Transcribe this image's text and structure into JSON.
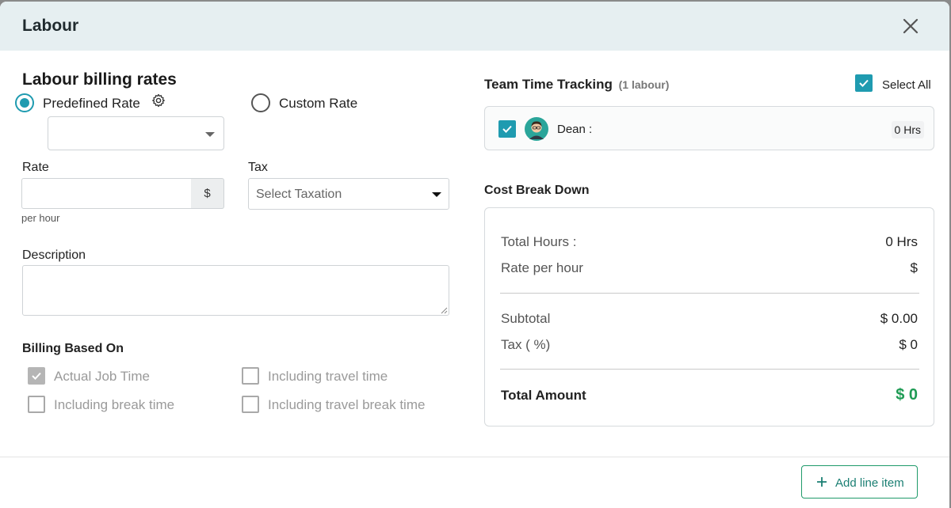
{
  "modal": {
    "title": "Labour"
  },
  "billing": {
    "heading": "Labour billing rates",
    "predefined_label": "Predefined Rate",
    "custom_label": "Custom Rate",
    "selected": "predefined",
    "rate_label": "Rate",
    "rate_value": "",
    "currency_symbol": "$",
    "per_hour": "per hour",
    "tax_label": "Tax",
    "tax_placeholder": "Select Taxation",
    "description_label": "Description",
    "description_value": ""
  },
  "billing_based_on": {
    "heading": "Billing Based On",
    "options": [
      {
        "label": "Actual Job Time",
        "checked": true
      },
      {
        "label": "Including travel time",
        "checked": false
      },
      {
        "label": "Including break time",
        "checked": false
      },
      {
        "label": "Including travel break time",
        "checked": false
      }
    ]
  },
  "team": {
    "heading": "Team Time Tracking",
    "count_label": "(1 labour)",
    "select_all_label": "Select All",
    "select_all_checked": true,
    "members": [
      {
        "name": "Dean :",
        "hours": "0 Hrs",
        "checked": true
      }
    ]
  },
  "cost": {
    "heading": "Cost Break Down",
    "total_hours_label": "Total Hours :",
    "total_hours_value": "0 Hrs",
    "rate_label": "Rate per hour",
    "rate_value": "$",
    "subtotal_label": "Subtotal",
    "subtotal_value": "$ 0.00",
    "tax_label": "Tax ( %)",
    "tax_value": "$ 0",
    "total_label": "Total Amount",
    "total_value": "$ 0"
  },
  "footer": {
    "add_label": "Add line item"
  },
  "colors": {
    "accent": "#1f9bb0",
    "total_green": "#1e9b54",
    "header_bg": "#e6eff1"
  }
}
